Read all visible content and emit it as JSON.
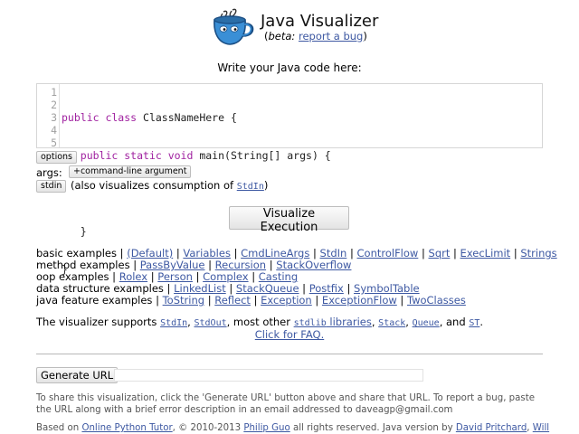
{
  "header": {
    "title": "Java Visualizer",
    "beta_prefix": "(",
    "beta_word": "beta:",
    "bug_link": "report a bug",
    "beta_suffix": ")"
  },
  "prompt": "Write your Java code here:",
  "editor": {
    "line_numbers": [
      "1",
      "2",
      "3",
      "4",
      "5"
    ],
    "lines": [
      {
        "kw": "public class",
        "rest": " ClassNameHere {"
      },
      {
        "indent": "   ",
        "kw": "public static void",
        "rest": " main(String[] args) {"
      },
      {
        "indent": "",
        "kw": "",
        "rest": ""
      },
      {
        "indent": "   ",
        "kw": "",
        "rest": "}"
      },
      {
        "indent": "",
        "kw": "",
        "rest": "}"
      }
    ]
  },
  "controls": {
    "options_label": "options",
    "args_label": "args:",
    "add_arg_label": "+command-line argument",
    "stdin_label": "stdin",
    "stdin_desc_prefix": "(also visualizes consumption of ",
    "stdin_desc_code": "StdIn",
    "stdin_desc_suffix": ")",
    "visualize_label": "Visualize Execution"
  },
  "examples": [
    {
      "label": "basic examples",
      "items": [
        "(Default)",
        "Variables",
        "CmdLineArgs",
        "StdIn",
        "ControlFlow",
        "Sqrt",
        "ExecLimit",
        "Strings"
      ]
    },
    {
      "label": "method examples",
      "items": [
        "PassByValue",
        "Recursion",
        "StackOverflow"
      ]
    },
    {
      "label": "oop examples",
      "items": [
        "Rolex",
        "Person",
        "Complex",
        "Casting"
      ]
    },
    {
      "label": "data structure examples",
      "items": [
        "LinkedList",
        "StackQueue",
        "Postfix",
        "SymbolTable"
      ]
    },
    {
      "label": "java feature examples",
      "items": [
        "ToString",
        "Reflect",
        "Exception",
        "ExceptionFlow",
        "TwoClasses"
      ]
    }
  ],
  "support": {
    "prefix": "The visualizer supports ",
    "stdin": "StdIn",
    "stdout": "StdOut",
    "mid": ", most other ",
    "stdlib": "stdlib",
    "libraries": " libraries",
    "stack": "Stack",
    "queue": "Queue",
    "and": ", and ",
    "st": "ST",
    "end": ".",
    "faq": "Click for FAQ."
  },
  "url": {
    "button_label": "Generate URL",
    "value": ""
  },
  "share_text": "To share this visualization, click the 'Generate URL' button above and share that URL. To report a bug, paste the URL along with a brief error description in an email addressed to daveagp@gmail.com",
  "footer": {
    "based_on": "Based on ",
    "opt_link": "Online Python Tutor",
    "copyright": ", © 2010-2013 ",
    "guo_link": "Philip Guo",
    "rights": " all rights reserved. Java version by ",
    "pritchard_link": "David Pritchard",
    "comma": ", ",
    "will_link": "Will"
  },
  "colors": {
    "link": "#3d58a2",
    "keyword": "#a022a0",
    "logo": "#3a8fd6"
  },
  "icons": {
    "logo": "coffee-cup-logo-icon"
  }
}
